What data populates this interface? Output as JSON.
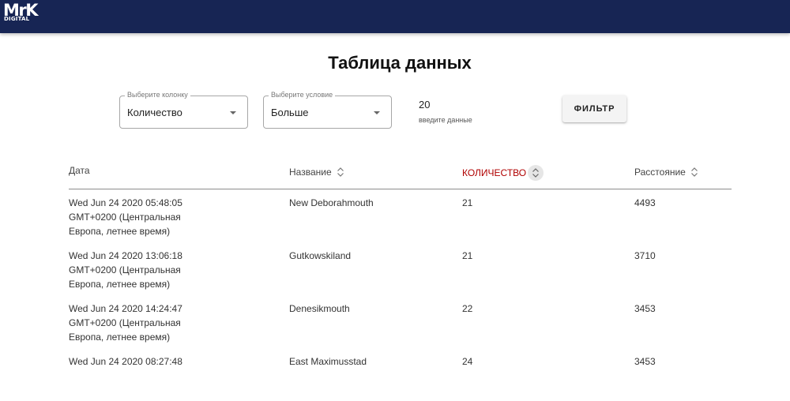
{
  "header": {
    "logo_main": "MrK",
    "logo_sub": "DIGITAL"
  },
  "page": {
    "title": "Таблица данных"
  },
  "filters": {
    "column": {
      "legend": "Выберите колонку",
      "value": "Количество"
    },
    "condition": {
      "legend": "Выберите условие",
      "value": "Больше"
    },
    "input": {
      "value": "20",
      "helper": "введите данные"
    },
    "button_label": "ФИЛЬТР"
  },
  "table": {
    "columns": [
      {
        "label": "Дата",
        "sortable": false
      },
      {
        "label": "Название",
        "sortable": true
      },
      {
        "label": "КОЛИЧЕСТВО",
        "sortable": true,
        "active": true
      },
      {
        "label": "Расстояние",
        "sortable": true
      }
    ],
    "rows": [
      {
        "date": "Wed Jun 24 2020 05:48:05 GMT+0200 (Центральная Европа, летнее время)",
        "name": "New Deborahmouth",
        "qty": "21",
        "dist": "4493"
      },
      {
        "date": "Wed Jun 24 2020 13:06:18 GMT+0200 (Центральная Европа, летнее время)",
        "name": "Gutkowskiland",
        "qty": "21",
        "dist": "3710"
      },
      {
        "date": "Wed Jun 24 2020 14:24:47 GMT+0200 (Центральная Европа, летнее время)",
        "name": "Denesikmouth",
        "qty": "22",
        "dist": "3453"
      },
      {
        "date": "Wed Jun 24 2020 08:27:48",
        "name": "East Maximusstad",
        "qty": "24",
        "dist": "3453"
      }
    ]
  },
  "colors": {
    "header_bg": "#172554",
    "active_sort": "#b00000"
  }
}
